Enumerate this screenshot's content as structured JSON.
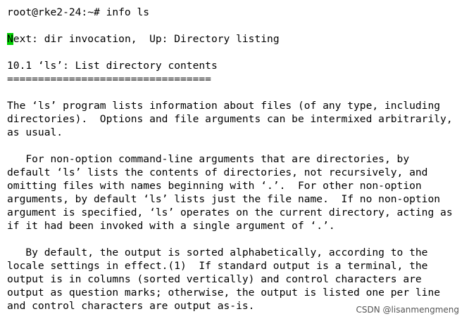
{
  "terminal": {
    "prompt": "root@rke2-24:~# info ls",
    "nav": {
      "cursor_char": "N",
      "rest": "ext: dir invocation,  Up: Directory listing"
    },
    "heading": "10.1 ‘ls’: List directory contents",
    "underline": "=================================",
    "para1": [
      "The ‘ls’ program lists information about files (of any type, including",
      "directories).  Options and file arguments can be intermixed arbitrarily,",
      "as usual."
    ],
    "para2": [
      "   For non-option command-line arguments that are directories, by",
      "default ‘ls’ lists the contents of directories, not recursively, and",
      "omitting files with names beginning with ‘.’.  For other non-option",
      "arguments, by default ‘ls’ lists just the file name.  If no non-option",
      "argument is specified, ‘ls’ operates on the current directory, acting as",
      "if it had been invoked with a single argument of ‘.’."
    ],
    "para3": [
      "   By default, the output is sorted alphabetically, according to the",
      "locale settings in effect.(1)  If standard output is a terminal, the",
      "output is in columns (sorted vertically) and control characters are",
      "output as question marks; otherwise, the output is listed one per line",
      "and control characters are output as-is."
    ]
  },
  "watermark": "CSDN @lisanmengmeng",
  "colors": {
    "background": "#ffffff",
    "text": "#000000",
    "cursor": "#00d000"
  }
}
